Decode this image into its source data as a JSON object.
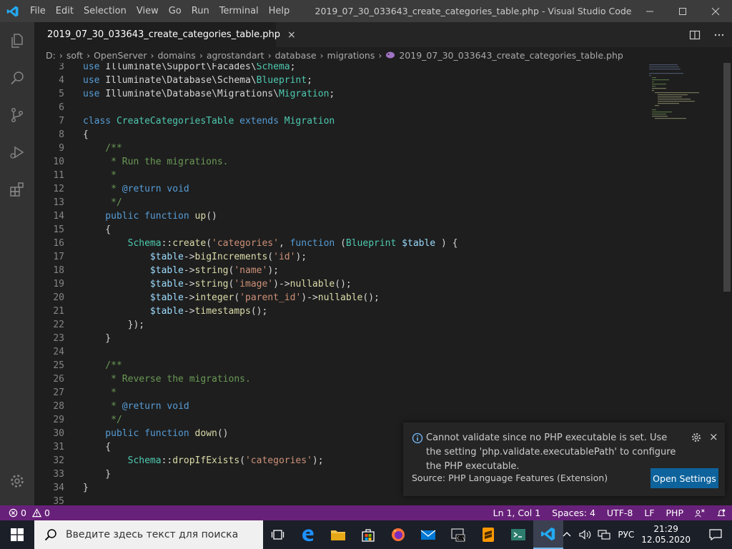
{
  "titlebar": {
    "menus": [
      "File",
      "Edit",
      "Selection",
      "View",
      "Go",
      "Run",
      "Terminal",
      "Help"
    ],
    "window_title": "2019_07_30_033643_create_categories_table.php - Visual Studio Code"
  },
  "tab": {
    "label": "2019_07_30_033643_create_categories_table.php",
    "close": "×"
  },
  "breadcrumbs": [
    "D:",
    "soft",
    "OpenServer",
    "domains",
    "agrostandart",
    "database",
    "migrations",
    "2019_07_30_033643_create_categories_table.php"
  ],
  "code": {
    "lines": [
      {
        "n": "3",
        "t": [
          [
            "kw",
            "use "
          ],
          [
            "",
            "Illuminate\\Support\\Facades\\"
          ],
          [
            "ty",
            "Schema"
          ],
          [
            "",
            ";"
          ]
        ]
      },
      {
        "n": "4",
        "t": [
          [
            "kw",
            "use "
          ],
          [
            "",
            "Illuminate\\Database\\Schema\\"
          ],
          [
            "ty",
            "Blueprint"
          ],
          [
            "",
            ";"
          ]
        ]
      },
      {
        "n": "5",
        "t": [
          [
            "kw",
            "use "
          ],
          [
            "",
            "Illuminate\\Database\\Migrations\\"
          ],
          [
            "ty",
            "Migration"
          ],
          [
            "",
            ";"
          ]
        ]
      },
      {
        "n": "6",
        "t": []
      },
      {
        "n": "7",
        "t": [
          [
            "kw",
            "class "
          ],
          [
            "ty",
            "CreateCategoriesTable "
          ],
          [
            "kw",
            "extends "
          ],
          [
            "ty",
            "Migration"
          ]
        ]
      },
      {
        "n": "8",
        "t": [
          [
            "",
            "{"
          ]
        ]
      },
      {
        "n": "9",
        "t": [
          [
            "cm",
            "    /**"
          ]
        ]
      },
      {
        "n": "10",
        "t": [
          [
            "cm",
            "     * Run the migrations."
          ]
        ]
      },
      {
        "n": "11",
        "t": [
          [
            "cm",
            "     *"
          ]
        ]
      },
      {
        "n": "12",
        "t": [
          [
            "cm",
            "     * "
          ],
          [
            "kw",
            "@return "
          ],
          [
            "kw",
            "void"
          ]
        ]
      },
      {
        "n": "13",
        "t": [
          [
            "cm",
            "     */"
          ]
        ]
      },
      {
        "n": "14",
        "t": [
          [
            "kw",
            "    public function "
          ],
          [
            "fn",
            "up"
          ],
          [
            "",
            "()"
          ]
        ]
      },
      {
        "n": "15",
        "t": [
          [
            "",
            "    {"
          ]
        ]
      },
      {
        "n": "16",
        "t": [
          [
            "ty",
            "        Schema"
          ],
          [
            "",
            "::"
          ],
          [
            "fn",
            "create"
          ],
          [
            "",
            "("
          ],
          [
            "st",
            "'categories'"
          ],
          [
            "",
            ", "
          ],
          [
            "kw",
            "function "
          ],
          [
            "",
            "("
          ],
          [
            "ty",
            "Blueprint "
          ],
          [
            "va",
            "$table"
          ],
          [
            "",
            " ) {"
          ]
        ]
      },
      {
        "n": "17",
        "t": [
          [
            "va",
            "            $table"
          ],
          [
            "",
            "->"
          ],
          [
            "fn",
            "bigIncrements"
          ],
          [
            "",
            "("
          ],
          [
            "st",
            "'id'"
          ],
          [
            "",
            ");"
          ]
        ]
      },
      {
        "n": "18",
        "t": [
          [
            "va",
            "            $table"
          ],
          [
            "",
            "->"
          ],
          [
            "fn",
            "string"
          ],
          [
            "",
            "("
          ],
          [
            "st",
            "'name'"
          ],
          [
            "",
            ");"
          ]
        ]
      },
      {
        "n": "19",
        "t": [
          [
            "va",
            "            $table"
          ],
          [
            "",
            "->"
          ],
          [
            "fn",
            "string"
          ],
          [
            "",
            "("
          ],
          [
            "st",
            "'image'"
          ],
          [
            "",
            ")->"
          ],
          [
            "fn",
            "nullable"
          ],
          [
            "",
            "();"
          ]
        ]
      },
      {
        "n": "20",
        "t": [
          [
            "va",
            "            $table"
          ],
          [
            "",
            "->"
          ],
          [
            "fn",
            "integer"
          ],
          [
            "",
            "("
          ],
          [
            "st",
            "'parent_id'"
          ],
          [
            "",
            ")->"
          ],
          [
            "fn",
            "nullable"
          ],
          [
            "",
            "();"
          ]
        ]
      },
      {
        "n": "21",
        "t": [
          [
            "va",
            "            $table"
          ],
          [
            "",
            "->"
          ],
          [
            "fn",
            "timestamps"
          ],
          [
            "",
            "();"
          ]
        ]
      },
      {
        "n": "22",
        "t": [
          [
            "",
            "        });"
          ]
        ]
      },
      {
        "n": "23",
        "t": [
          [
            "",
            "    }"
          ]
        ]
      },
      {
        "n": "24",
        "t": []
      },
      {
        "n": "25",
        "t": [
          [
            "cm",
            "    /**"
          ]
        ]
      },
      {
        "n": "26",
        "t": [
          [
            "cm",
            "     * Reverse the migrations."
          ]
        ]
      },
      {
        "n": "27",
        "t": [
          [
            "cm",
            "     *"
          ]
        ]
      },
      {
        "n": "28",
        "t": [
          [
            "cm",
            "     * "
          ],
          [
            "kw",
            "@return "
          ],
          [
            "kw",
            "void"
          ]
        ]
      },
      {
        "n": "29",
        "t": [
          [
            "cm",
            "     */"
          ]
        ]
      },
      {
        "n": "30",
        "t": [
          [
            "kw",
            "    public function "
          ],
          [
            "fn",
            "down"
          ],
          [
            "",
            "()"
          ]
        ]
      },
      {
        "n": "31",
        "t": [
          [
            "",
            "    {"
          ]
        ]
      },
      {
        "n": "32",
        "t": [
          [
            "ty",
            "        Schema"
          ],
          [
            "",
            "::"
          ],
          [
            "fn",
            "dropIfExists"
          ],
          [
            "",
            "("
          ],
          [
            "st",
            "'categories'"
          ],
          [
            "",
            ");"
          ]
        ]
      },
      {
        "n": "33",
        "t": [
          [
            "",
            "    }"
          ]
        ]
      },
      {
        "n": "34",
        "t": [
          [
            "",
            "}"
          ]
        ]
      },
      {
        "n": "35",
        "t": []
      }
    ]
  },
  "notification": {
    "message": "Cannot validate since no PHP executable is set. Use the setting 'php.validate.executablePath' to configure the PHP executable.",
    "source": "Source: PHP Language Features (Extension)",
    "button": "Open Settings",
    "close": "×"
  },
  "statusbar": {
    "errors": "0",
    "warnings": "0",
    "position": "Ln 1, Col 1",
    "spaces": "Spaces: 4",
    "encoding": "UTF-8",
    "eol": "LF",
    "language": "PHP"
  },
  "taskbar": {
    "search_placeholder": "Введите здесь текст для поиска",
    "lang": "РУС",
    "time": "21:29",
    "date": "12.05.2020"
  },
  "colors": {
    "statusbar": "#68217a",
    "accent_button": "#0e639c",
    "vscode_blue": "#23a9f2"
  }
}
